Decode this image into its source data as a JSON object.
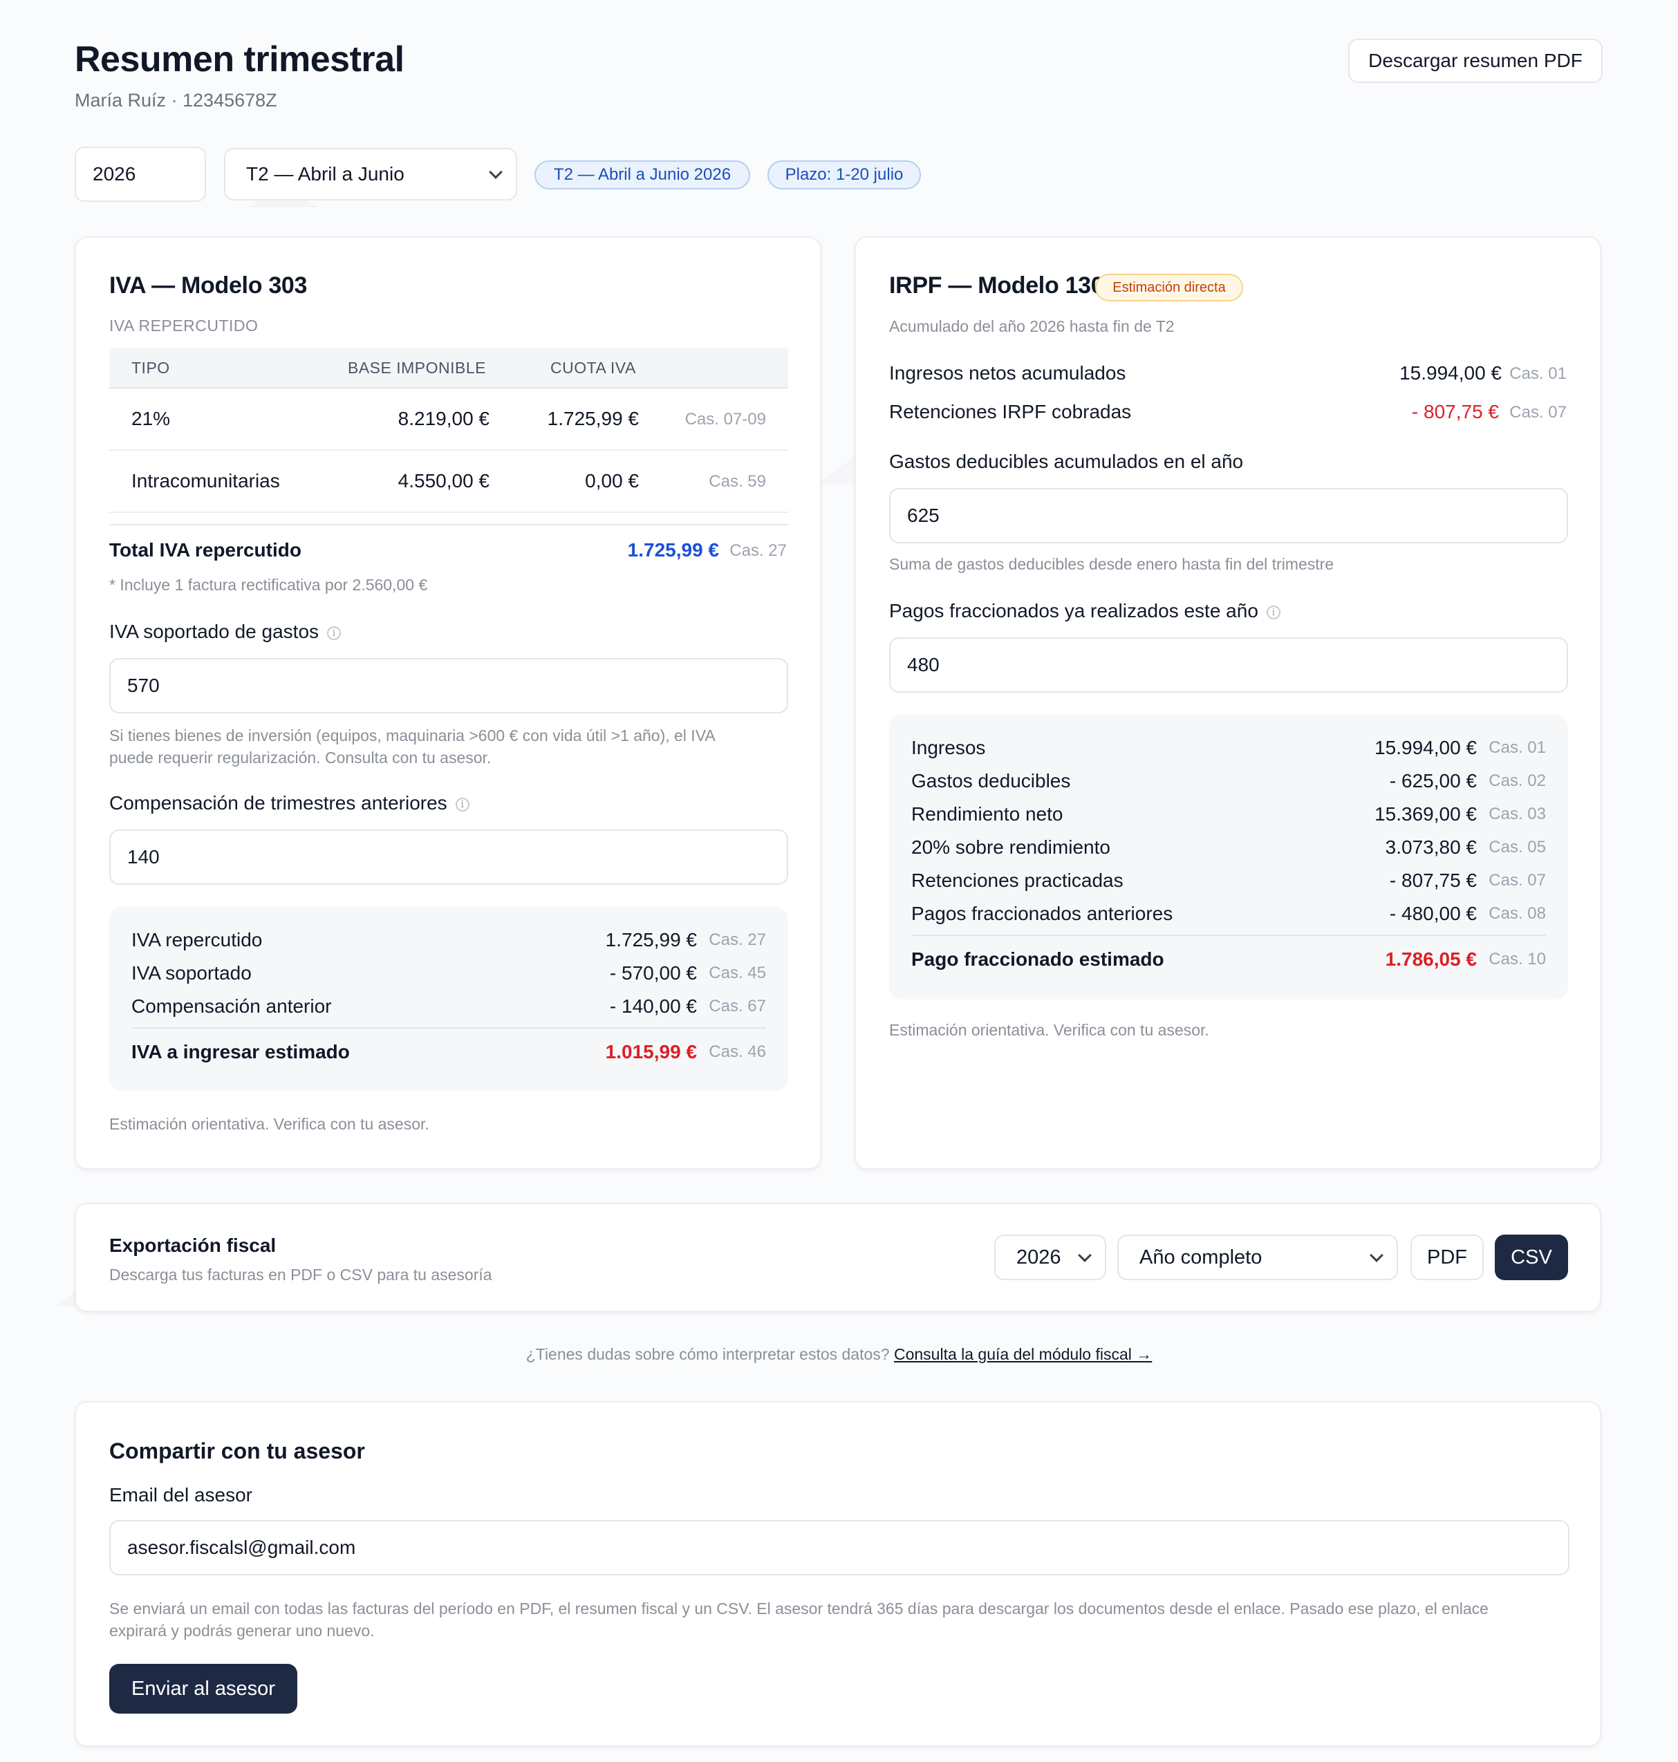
{
  "header": {
    "title": "Resumen trimestral",
    "subtitle": "María Ruíz · 12345678Z",
    "download_pdf": "Descargar resumen PDF"
  },
  "filters": {
    "year": "2026",
    "quarter": "T2 — Abril a Junio",
    "period_pill": "T2 — Abril a Junio 2026",
    "deadline_pill": "Plazo: 1-20 julio"
  },
  "iva": {
    "title": "IVA — Modelo 303",
    "section": "IVA REPERCUTIDO",
    "columns": [
      "TIPO",
      "BASE IMPONIBLE",
      "CUOTA IVA"
    ],
    "rows": [
      {
        "tipo": "21%",
        "base": "8.219,00 €",
        "cuota": "1.725,99 €",
        "cas": "Cas. 07-09"
      },
      {
        "tipo": "Intracomunitarias",
        "base": "4.550,00 €",
        "cuota": "0,00 €",
        "cas": "Cas. 59"
      }
    ],
    "total_label": "Total IVA repercutido",
    "total_value": "1.725,99 €",
    "total_cas": "Cas. 27",
    "rectificativa_note": "* Incluye 1 factura rectificativa por 2.560,00 €",
    "soportado_label": "IVA soportado de gastos",
    "soportado_value": "570",
    "soportado_note_1": "Si tienes bienes de inversión (equipos, maquinaria >600 € con vida útil >1 año), el IVA",
    "soportado_note_2": "puede requerir regularización. Consulta con tu asesor.",
    "compensacion_label": "Compensación de trimestres anteriores",
    "compensacion_value": "140",
    "summary": [
      {
        "k": "IVA repercutido",
        "v": "1.725,99 €",
        "c": "Cas. 27"
      },
      {
        "k": "IVA soportado",
        "v": "- 570,00 €",
        "c": "Cas. 45"
      },
      {
        "k": "Compensación anterior",
        "v": "- 140,00 €",
        "c": "Cas. 67"
      }
    ],
    "result_label": "IVA a ingresar estimado",
    "result_value": "1.015,99 €",
    "result_cas": "Cas. 46",
    "disclaimer": "Estimación orientativa. Verifica con tu asesor."
  },
  "irpf": {
    "title": "IRPF — Modelo 130",
    "badge": "Estimación directa",
    "subtitle": "Acumulado del año 2026 hasta fin de T2",
    "ingresos_label": "Ingresos netos acumulados",
    "ingresos_value": "15.994,00 €",
    "ingresos_cas": "Cas. 01",
    "retenciones_label": "Retenciones IRPF cobradas",
    "retenciones_value": "- 807,75 €",
    "retenciones_cas": "Cas. 07",
    "gastos_label": "Gastos deducibles acumulados en el año",
    "gastos_value": "625",
    "gastos_note": "Suma de gastos deducibles desde enero hasta fin del trimestre",
    "pagos_label": "Pagos fraccionados ya realizados este año",
    "pagos_value": "480",
    "summary": [
      {
        "k": "Ingresos",
        "v": "15.994,00 €",
        "c": "Cas. 01"
      },
      {
        "k": "Gastos deducibles",
        "v": "- 625,00 €",
        "c": "Cas. 02"
      },
      {
        "k": "Rendimiento neto",
        "v": "15.369,00 €",
        "c": "Cas. 03"
      },
      {
        "k": "20% sobre rendimiento",
        "v": "3.073,80 €",
        "c": "Cas. 05"
      },
      {
        "k": "Retenciones practicadas",
        "v": "- 807,75 €",
        "c": "Cas. 07"
      },
      {
        "k": "Pagos fraccionados anteriores",
        "v": "- 480,00 €",
        "c": "Cas. 08"
      }
    ],
    "result_label": "Pago fraccionado estimado",
    "result_value": "1.786,05 €",
    "result_cas": "Cas. 10",
    "disclaimer": "Estimación orientativa. Verifica con tu asesor."
  },
  "export": {
    "title": "Exportación fiscal",
    "subtitle": "Descarga tus facturas en PDF o CSV para tu asesoría",
    "year": "2026",
    "range": "Año completo",
    "pdf": "PDF",
    "csv": "CSV"
  },
  "help": {
    "question": "¿Tienes dudas sobre cómo interpretar estos datos? ",
    "link": "Consulta la guía del módulo fiscal →"
  },
  "share": {
    "title": "Compartir con tu asesor",
    "email_label": "Email del asesor",
    "email_value": "asesor.fiscalsl@gmail.com",
    "note_1": "Se enviará un email con todas las facturas del período en PDF, el resumen fiscal y un CSV. El asesor tendrá 365 días para descargar los documentos desde el enlace. Pasado ese plazo, el enlace",
    "note_2": "expirará y podrás generar uno nuevo.",
    "send": "Enviar al asesor"
  },
  "icons": {
    "info": "info-icon",
    "chevron": "chevron-down-icon",
    "arrow": "arrow-right-icon"
  },
  "colors": {
    "accent_dark": "#1e2a44",
    "negative_red": "#dc1f26",
    "positive_blue": "#1d4fd8",
    "pill_blue": "#eaf2fd",
    "badge_amber": "#fff7e6"
  }
}
